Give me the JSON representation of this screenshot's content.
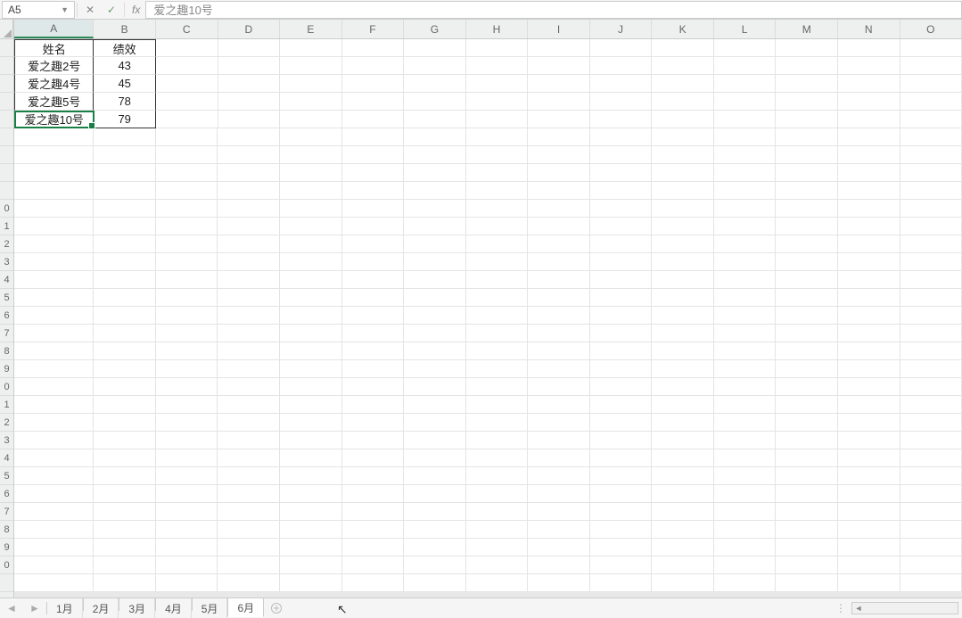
{
  "namebox": {
    "value": "A5"
  },
  "formula": {
    "fx": "fx",
    "value": "爱之趣10号"
  },
  "columns": [
    "A",
    "B",
    "C",
    "D",
    "E",
    "F",
    "G",
    "H",
    "I",
    "J",
    "K",
    "L",
    "M",
    "N",
    "O"
  ],
  "row_numbers": [
    "",
    "",
    "",
    "",
    "",
    "",
    "",
    "",
    "",
    "0",
    "1",
    "2",
    "3",
    "4",
    "5",
    "6",
    "7",
    "8",
    "9",
    "0",
    "1",
    "2",
    "3",
    "4",
    "5",
    "6",
    "7",
    "8",
    "9",
    "0"
  ],
  "table": {
    "header": {
      "name": "姓名",
      "perf": "绩效"
    },
    "rows": [
      {
        "name": "爱之趣2号",
        "perf": "43"
      },
      {
        "name": "爱之趣4号",
        "perf": "45"
      },
      {
        "name": "爱之趣5号",
        "perf": "78"
      },
      {
        "name": "爱之趣10号",
        "perf": "79"
      }
    ]
  },
  "tabs": {
    "items": [
      {
        "label": "1月"
      },
      {
        "label": "2月"
      },
      {
        "label": "3月"
      },
      {
        "label": "4月"
      },
      {
        "label": "5月"
      },
      {
        "label": "6月"
      }
    ],
    "active_index": 5
  }
}
